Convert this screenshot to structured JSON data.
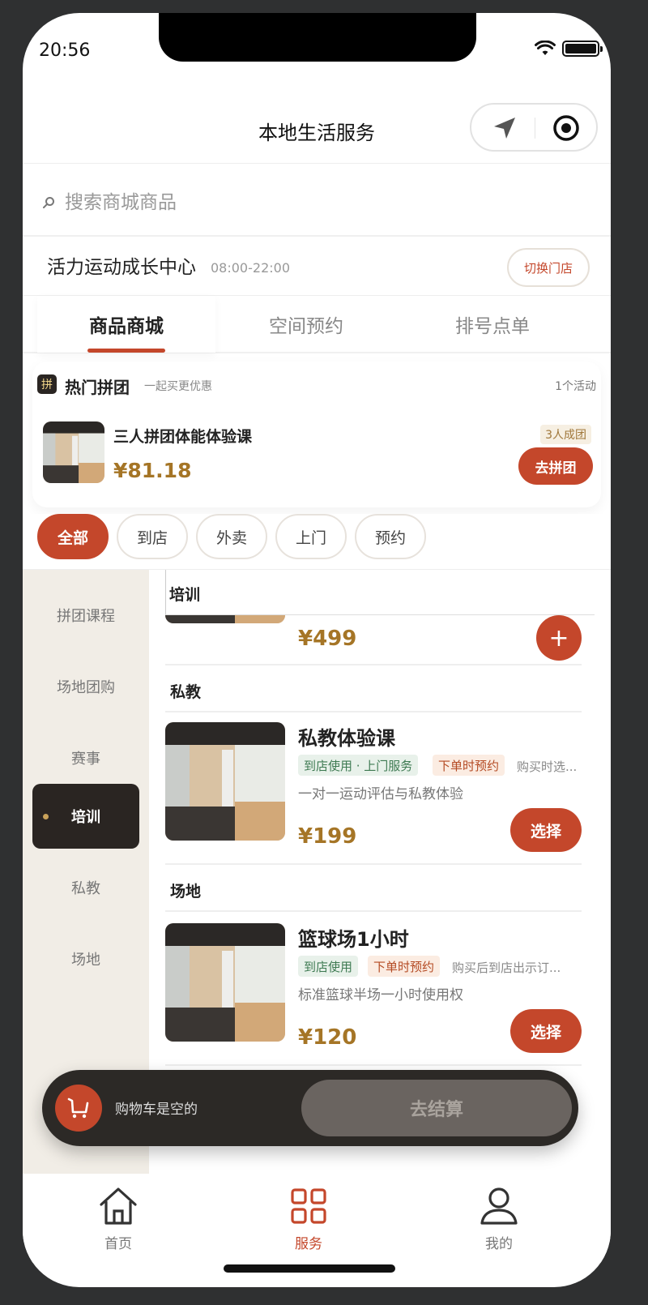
{
  "status": {
    "time": "20:56"
  },
  "header": {
    "title": "本地生活服务"
  },
  "search": {
    "placeholder": "搜索商城商品"
  },
  "store": {
    "name": "活力运动成长中心",
    "hours": "08:00-22:00",
    "switch_label": "切换门店"
  },
  "tabs": [
    {
      "label": "商品商城",
      "active": true
    },
    {
      "label": "空间预约",
      "active": false
    },
    {
      "label": "排号点单",
      "active": false
    }
  ],
  "group_buy": {
    "badge": "拼",
    "title": "热门拼团",
    "subtitle": "一起买更优惠",
    "count": "1个活动",
    "item": {
      "name": "三人拼团体能体验课",
      "price": "¥81.18",
      "tag": "3人成团",
      "button": "去拼团"
    }
  },
  "filters": [
    {
      "label": "全部",
      "active": true
    },
    {
      "label": "到店",
      "active": false
    },
    {
      "label": "外卖",
      "active": false
    },
    {
      "label": "上门",
      "active": false
    },
    {
      "label": "预约",
      "active": false
    }
  ],
  "sidebar": {
    "items": [
      {
        "label": "拼团课程",
        "active": false
      },
      {
        "label": "场地团购",
        "active": false
      },
      {
        "label": "赛事",
        "active": false
      },
      {
        "label": "培训",
        "active": true
      },
      {
        "label": "私教",
        "active": false
      },
      {
        "label": "场地",
        "active": false
      }
    ]
  },
  "sections": {
    "training": {
      "title": "培训",
      "price": "¥499",
      "add_label": "+"
    },
    "private": {
      "title": "私教",
      "item": {
        "name": "私教体验课",
        "tag1": "到店使用 · 上门服务",
        "tag2": "下单时预约",
        "note": "购买时选...",
        "desc": "一对一运动评估与私教体验",
        "price": "¥199",
        "button": "选择"
      }
    },
    "venue": {
      "title": "场地",
      "item": {
        "name": "篮球场1小时",
        "tag1": "到店使用",
        "tag2": "下单时预约",
        "note": "购买后到店出示订...",
        "desc": "标准篮球半场一小时使用权",
        "price": "¥120",
        "button": "选择"
      }
    }
  },
  "cart": {
    "empty_text": "购物车是空的",
    "checkout_label": "去结算"
  },
  "tabbar": [
    {
      "label": "首页",
      "icon": "home-icon",
      "active": false
    },
    {
      "label": "服务",
      "icon": "grid-icon",
      "active": true
    },
    {
      "label": "我的",
      "icon": "user-icon",
      "active": false
    }
  ],
  "colors": {
    "accent": "#c4472b",
    "price": "#a57526",
    "dark": "#2a2522",
    "sidebar_bg": "#f1ede6"
  }
}
